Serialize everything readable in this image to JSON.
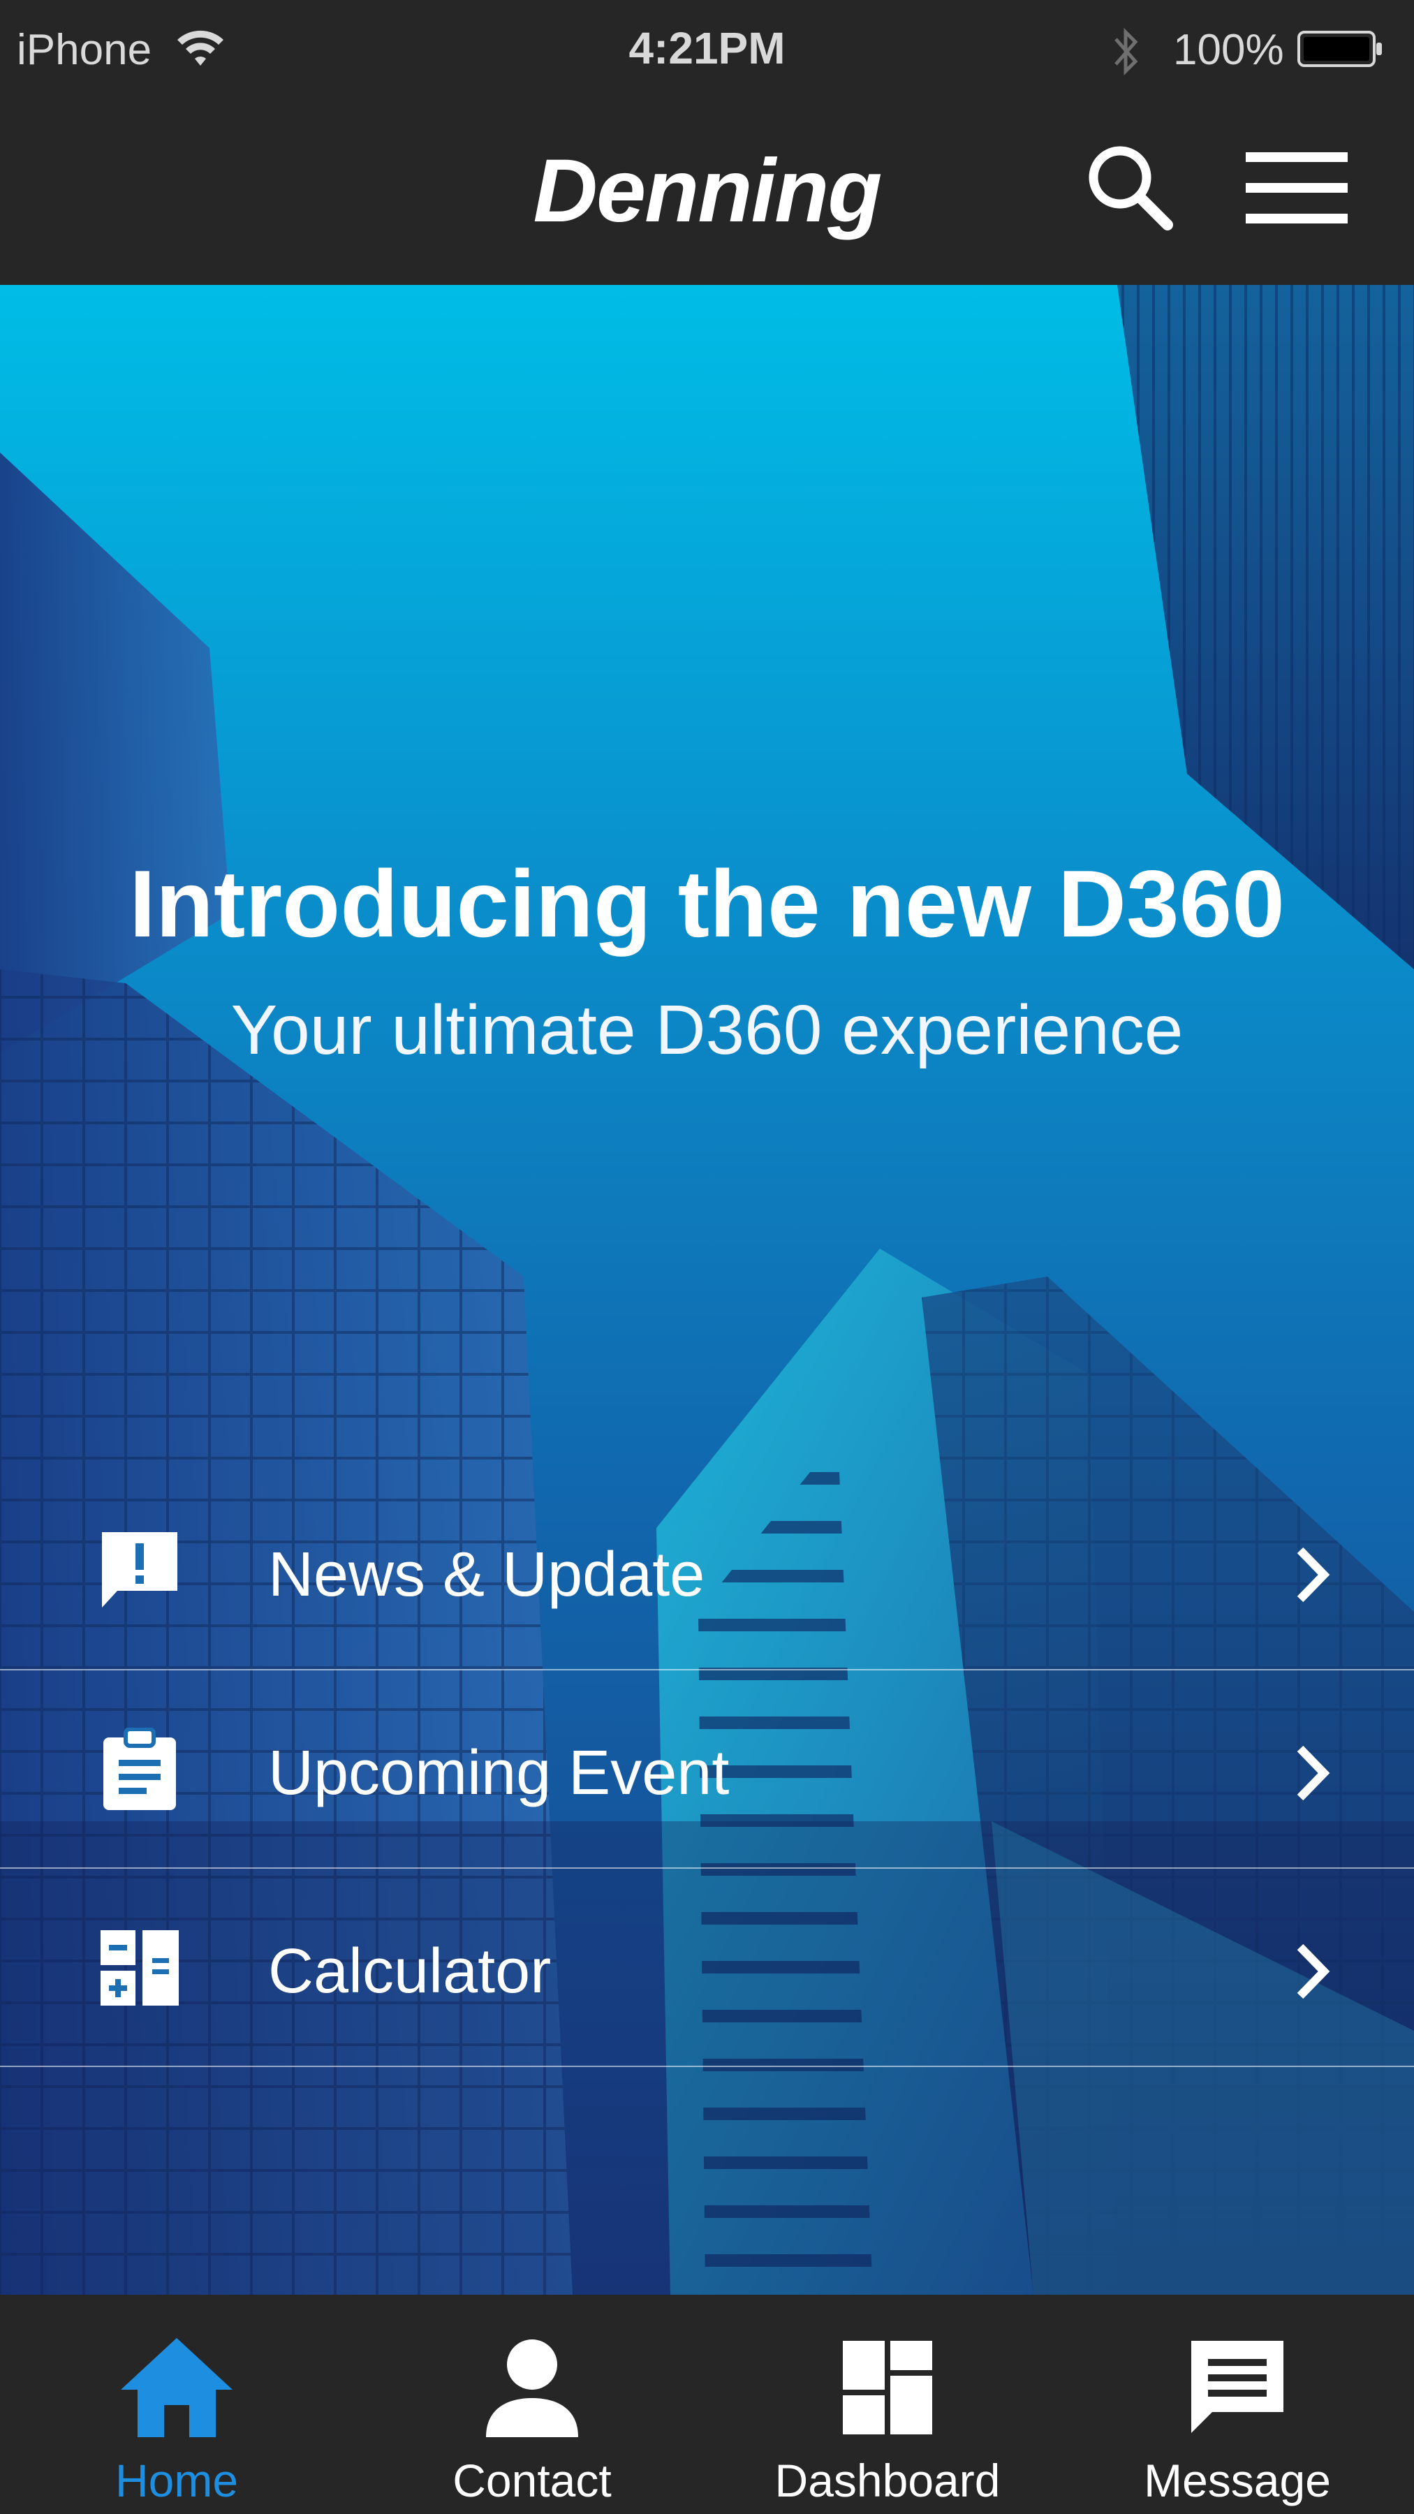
{
  "status_bar": {
    "carrier": "iPhone",
    "time": "4:21PM",
    "battery": "100%"
  },
  "app_bar": {
    "logo": "Denning",
    "search_icon": "search-icon",
    "menu_icon": "hamburger-menu-icon"
  },
  "hero": {
    "title": "Introducing the new D360",
    "subtitle": "Your ultimate D360 experience"
  },
  "menu": [
    {
      "label": "News & Update",
      "icon": "announcement-icon"
    },
    {
      "label": "Upcoming Event",
      "icon": "clipboard-icon"
    },
    {
      "label": "Calculator",
      "icon": "calculator-icon"
    }
  ],
  "bottom_nav": {
    "active": "Home",
    "items": [
      {
        "label": "Home",
        "icon": "home-icon"
      },
      {
        "label": "Contact",
        "icon": "person-icon"
      },
      {
        "label": "Dashboard",
        "icon": "dashboard-icon"
      },
      {
        "label": "Message",
        "icon": "message-icon"
      }
    ]
  },
  "colors": {
    "bar_background": "#262626",
    "active_tab": "#1e8fe0",
    "hero_top": "#00bde6",
    "hero_bottom": "#1a3f88"
  }
}
